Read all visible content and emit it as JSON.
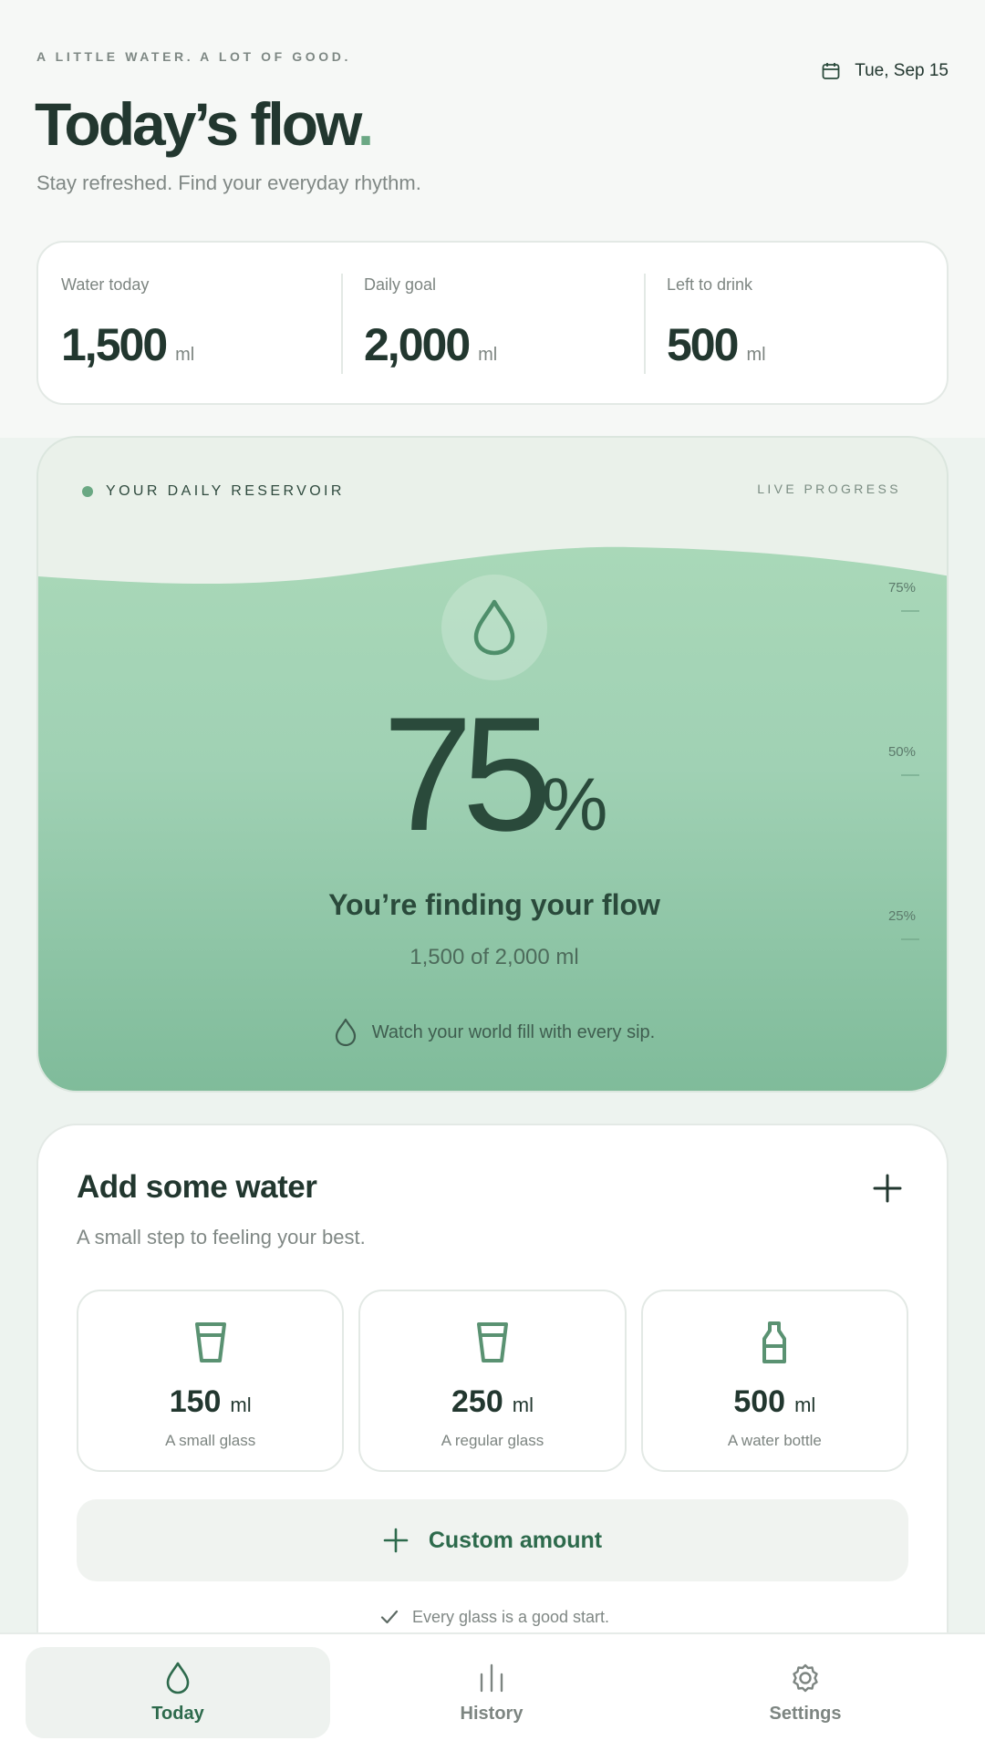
{
  "header": {
    "eyebrow": "A LITTLE WATER. A LOT OF GOOD.",
    "date": "Tue, Sep 15",
    "title": "Today’s flow",
    "title_dot": ".",
    "subtitle": "Stay refreshed. Find your everyday rhythm."
  },
  "stats": [
    {
      "label": "Water today",
      "value": "1,500",
      "unit": "ml"
    },
    {
      "label": "Daily goal",
      "value": "2,000",
      "unit": "ml"
    },
    {
      "label": "Left to drink",
      "value": "500",
      "unit": "ml"
    }
  ],
  "reservoir": {
    "label": "YOUR DAILY RESERVOIR",
    "live": "LIVE PROGRESS",
    "ticks": [
      "75%",
      "50%",
      "25%"
    ],
    "progress": 0.75,
    "percent": "75",
    "percent_sign": "%",
    "message": "You’re finding your flow",
    "amount": "1,500 of 2,000 ml",
    "hint": "Watch your world fill with every sip."
  },
  "add_water": {
    "title": "Add some water",
    "subtitle": "A small step to feeling your best.",
    "options": [
      {
        "amount": "150",
        "unit": "ml",
        "desc": "A small glass",
        "icon": "glass-icon"
      },
      {
        "amount": "250",
        "unit": "ml",
        "desc": "A regular glass",
        "icon": "glass-icon"
      },
      {
        "amount": "500",
        "unit": "ml",
        "desc": "A water bottle",
        "icon": "bottle-icon"
      }
    ],
    "custom_label": "Custom amount",
    "encouragement": "Every glass is a good start."
  },
  "nav": [
    {
      "label": "Today",
      "icon": "drop-icon",
      "active": true
    },
    {
      "label": "History",
      "icon": "bars-icon",
      "active": false
    },
    {
      "label": "Settings",
      "icon": "gear-icon",
      "active": false
    }
  ],
  "colors": {
    "accent": "#2d6a4c",
    "water_light": "#a9d8b8",
    "water_dark": "#7fbb9a",
    "text_dark": "#22372f"
  }
}
